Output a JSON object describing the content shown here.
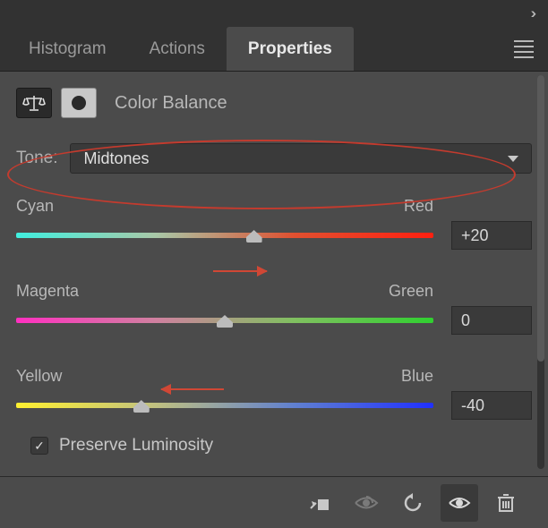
{
  "tabs": {
    "histogram": "Histogram",
    "actions": "Actions",
    "properties": "Properties"
  },
  "panel": {
    "title": "Color Balance"
  },
  "tone": {
    "label": "Tone:",
    "value": "Midtones"
  },
  "sliders": {
    "s1": {
      "left": "Cyan",
      "right": "Red",
      "value": "+20",
      "pos": 57
    },
    "s2": {
      "left": "Magenta",
      "right": "Green",
      "value": "0",
      "pos": 50
    },
    "s3": {
      "left": "Yellow",
      "right": "Blue",
      "value": "-40",
      "pos": 30
    }
  },
  "preserve": {
    "label": "Preserve Luminosity",
    "checked": true
  },
  "colors": {
    "grad1": "linear-gradient(90deg,#40f0e0,#a8c8a8,#e05030,#ff2010)",
    "grad2": "linear-gradient(90deg,#ff30c0,#d080a0,#80c060,#30d030)",
    "grad3": "linear-gradient(90deg,#fff030,#c0c080,#6080d0,#2030ff)"
  }
}
